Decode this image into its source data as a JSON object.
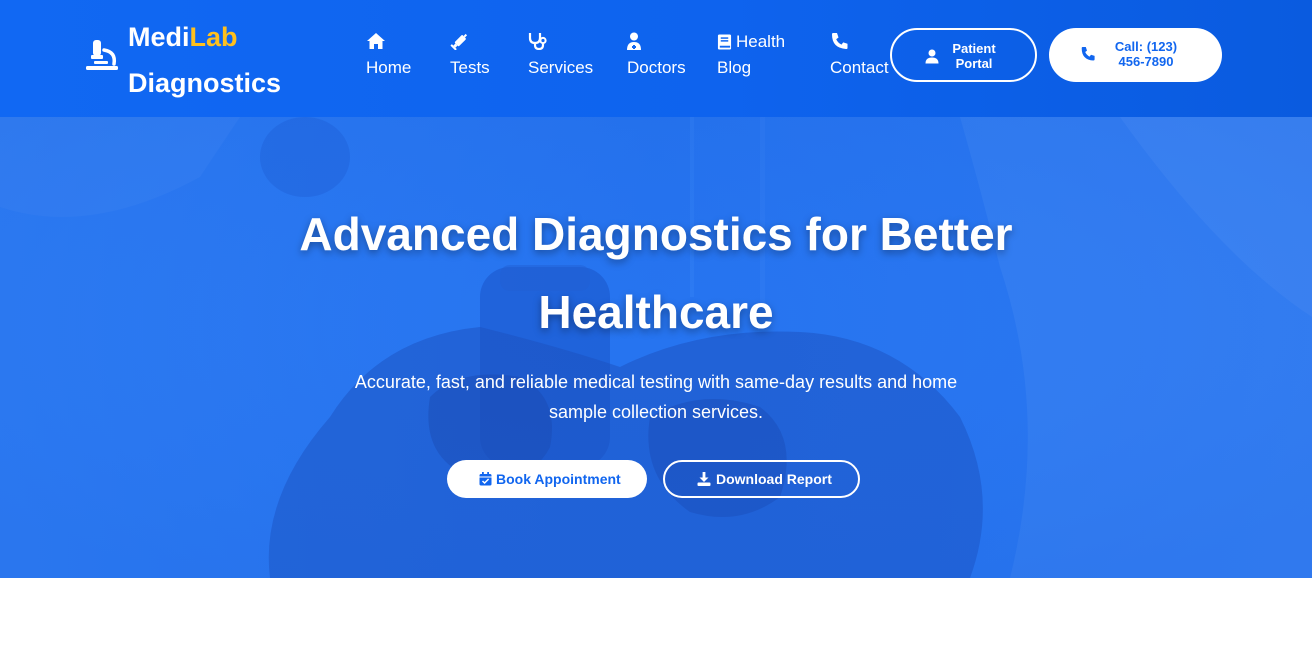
{
  "brand": {
    "name_part1": "Medi",
    "name_part2": "Lab",
    "name_line2": "Diagnostics",
    "accent_color": "#ffc01e",
    "icon": "microscope-icon"
  },
  "nav": {
    "items": [
      {
        "label": "Home",
        "icon": "home-icon"
      },
      {
        "label": "Tests",
        "icon": "syringe-icon"
      },
      {
        "label": "Services",
        "icon": "stethoscope-icon"
      },
      {
        "label": "Doctors",
        "icon": "doctor-icon"
      },
      {
        "label_line1": "Health",
        "label_line2": "Blog",
        "icon": "book-icon"
      },
      {
        "label": "Contact",
        "icon": "phone-icon"
      }
    ]
  },
  "header_buttons": {
    "portal": {
      "line1": "Patient",
      "line2": "Portal",
      "icon": "user-icon"
    },
    "call": {
      "line1": "Call: (123)",
      "line2": "456-7890",
      "icon": "phone-icon"
    }
  },
  "hero": {
    "title_line1": "Advanced Diagnostics for Better",
    "title_line2": "Healthcare",
    "subtitle_line1": "Accurate, fast, and reliable medical testing with same-day results and home",
    "subtitle_line2": "sample collection services.",
    "primary_button": {
      "label": "Book Appointment",
      "icon": "calendar-check-icon"
    },
    "secondary_button": {
      "label": "Download Report",
      "icon": "download-icon"
    }
  },
  "colors": {
    "primary": "#1166ef",
    "hero_overlay": "#2a7af4",
    "white": "#ffffff"
  }
}
